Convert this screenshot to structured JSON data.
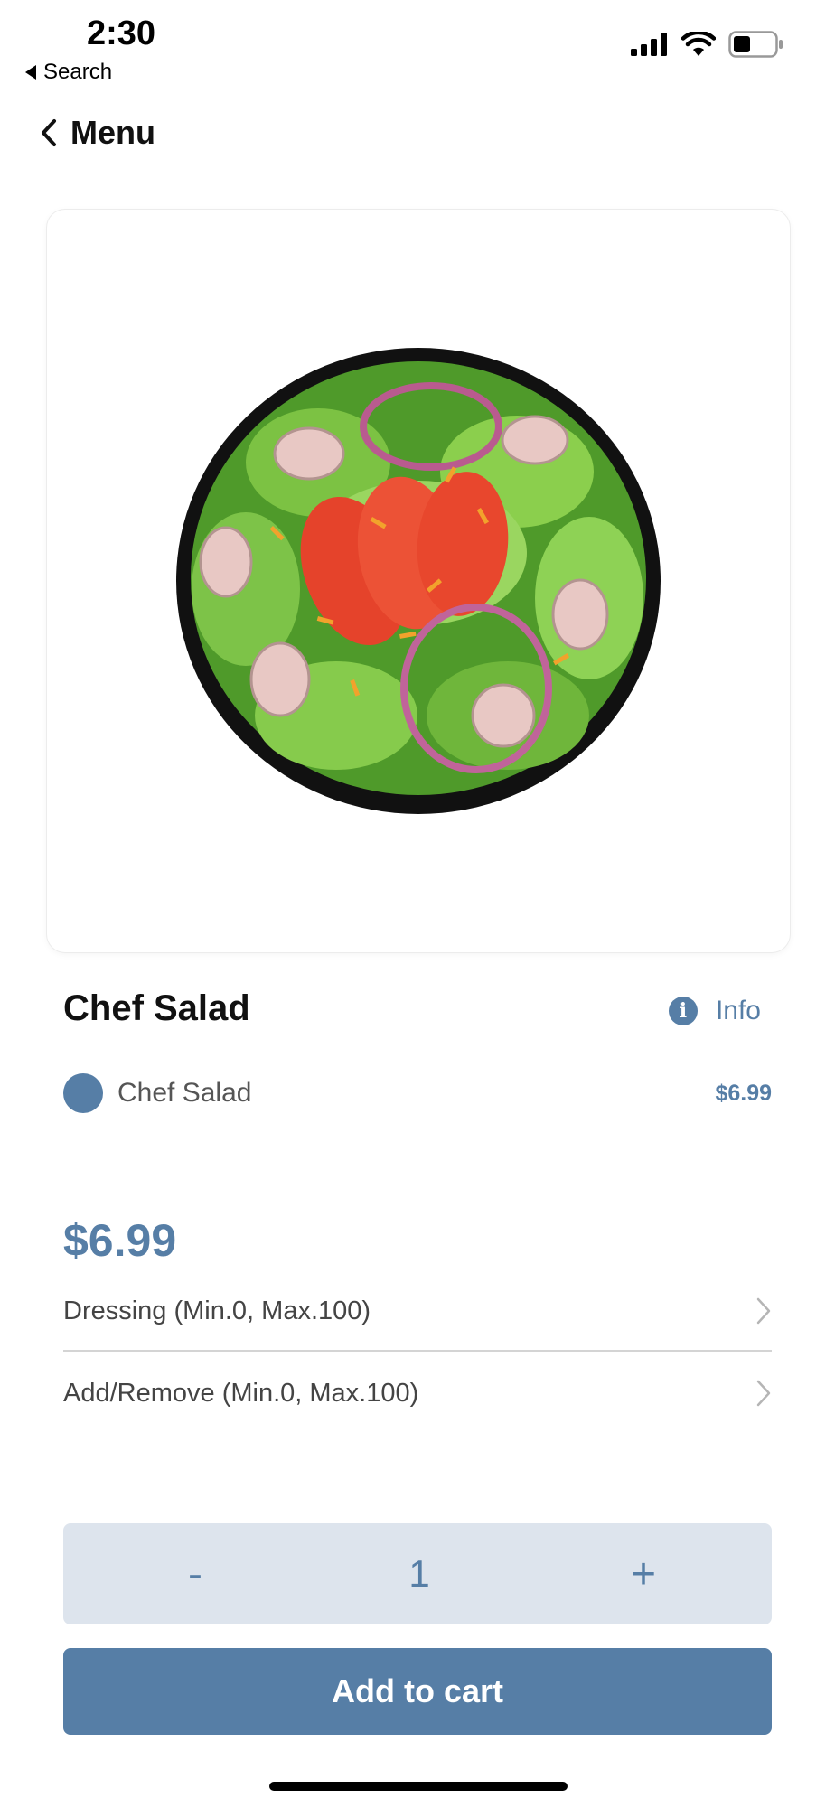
{
  "status_bar": {
    "time": "2:30",
    "back_app": "Search"
  },
  "nav": {
    "back_label": "Menu"
  },
  "item": {
    "name": "Chef Salad",
    "info_label": "Info",
    "options": [
      {
        "label": "Chef Salad",
        "price": "$6.99",
        "selected": true
      }
    ],
    "price": "$6.99"
  },
  "modifiers": [
    {
      "label": "Dressing (Min.0, Max.100)"
    },
    {
      "label": "Add/Remove (Min.0, Max.100)"
    }
  ],
  "quantity": {
    "minus": "-",
    "value": "1",
    "plus": "+"
  },
  "cart_button": {
    "label": "Add to cart"
  },
  "colors": {
    "accent": "#567ea6",
    "stepper_bg": "#dde4ed"
  }
}
